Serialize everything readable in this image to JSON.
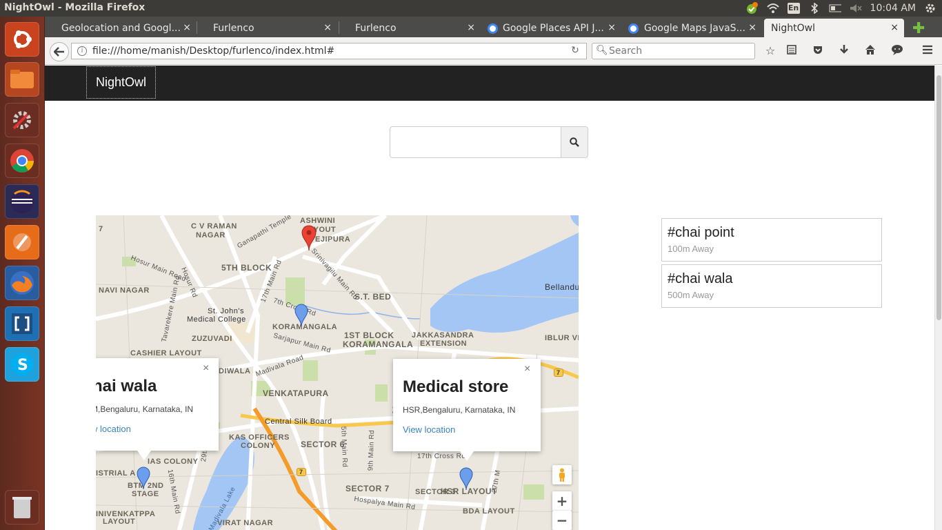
{
  "os": {
    "window_title": "NightOwl - Mozilla Firefox",
    "clock": "10:04 AM",
    "keyboard": "En"
  },
  "browser": {
    "tabs": [
      {
        "label": "Geolocation and Googl..."
      },
      {
        "label": "Furlenco"
      },
      {
        "label": "Furlenco"
      },
      {
        "label": "Google Places API J..."
      },
      {
        "label": "Google Maps JavaS..."
      },
      {
        "label": "NightOwl"
      }
    ],
    "url": "file:///home/manish/Desktop/furlenco/index.html#",
    "search_placeholder": "Search"
  },
  "app": {
    "brand": "NightOwl",
    "search_value": ""
  },
  "map": {
    "labels": [
      {
        "text": "C V RAMAN"
      },
      {
        "text": "NAGAR"
      },
      {
        "text": "ASHWINI"
      },
      {
        "text": "LAYOUT"
      },
      {
        "text": "EJIPURA"
      },
      {
        "text": "5TH BLOCK"
      },
      {
        "text": "S.T. BED"
      },
      {
        "text": "NAVI NAGAR"
      },
      {
        "text": "KORAMANGALA"
      },
      {
        "text": "1ST BLOCK"
      },
      {
        "text": "KORAMANGALA"
      },
      {
        "text": "JAKKASANDRA"
      },
      {
        "text": "EXTENSION"
      },
      {
        "text": "ZUZUVADI"
      },
      {
        "text": "CASHIER LAYOUT"
      },
      {
        "text": "VENKATAPURA"
      },
      {
        "text": "SECTOR 6"
      },
      {
        "text": "KAS OFFICERS"
      },
      {
        "text": "COLONY"
      },
      {
        "text": "SECTOR 7"
      },
      {
        "text": "SECTOR 3"
      },
      {
        "text": "HSR LAYOUT"
      },
      {
        "text": "BDA LAYOUT"
      },
      {
        "text": "IBLUR VIL"
      },
      {
        "text": "VIRAT NAGAR"
      },
      {
        "text": "LAYOUT"
      },
      {
        "text": "IAS COLONY"
      },
      {
        "text": "ISTRIAL A"
      },
      {
        "text": "BTM 2ND"
      },
      {
        "text": "STAGE"
      },
      {
        "text": "INIVENKATPPA"
      },
      {
        "text": "Bellandu"
      },
      {
        "text": "Central Silk Board"
      },
      {
        "text": "St. John's"
      },
      {
        "text": "Medical College"
      },
      {
        "text": "Hosur Main Road"
      },
      {
        "text": "Hosur Rd"
      },
      {
        "text": "17th Main Rd"
      },
      {
        "text": "7th Cross Rd"
      },
      {
        "text": "Srinivagilu Main Rd"
      },
      {
        "text": "Sarjapur Main Rd"
      },
      {
        "text": "Madivala Road"
      },
      {
        "text": "Tavarekere Main Rd"
      },
      {
        "text": "29th M"
      },
      {
        "text": "16th Main Rd"
      },
      {
        "text": "5th Main Rd"
      },
      {
        "text": "9th Main Rd"
      },
      {
        "text": "17th Cross Rd"
      },
      {
        "text": "27th M"
      },
      {
        "text": "Hospalya Main Rd"
      },
      {
        "text": "Madivala Lake"
      },
      {
        "text": "Ganapathi Temple"
      },
      {
        "text": "7"
      },
      {
        "text": "7"
      },
      {
        "text": "7"
      },
      {
        "text": "DIWALA"
      },
      {
        "text": "14t"
      }
    ],
    "info_windows": [
      {
        "title": "hai wala",
        "address": "M,Bengaluru, Karnataka, IN",
        "link": "w location"
      },
      {
        "title": "Medical store",
        "address": "HSR,Bengaluru, Karnataka, IN",
        "link": "View location"
      }
    ],
    "close_symbol": "×",
    "zoom_in": "+",
    "zoom_out": "−"
  },
  "results": [
    {
      "name": "#chai point",
      "distance": "100m Away"
    },
    {
      "name": "#chai wala",
      "distance": "500m Away"
    }
  ],
  "colors": {
    "navbar": "#222222",
    "map_bg": "#ebe7df",
    "water": "#a4c6f4",
    "park": "#cadfaa",
    "highway": "#f8c84a",
    "link": "#3a84c1"
  }
}
